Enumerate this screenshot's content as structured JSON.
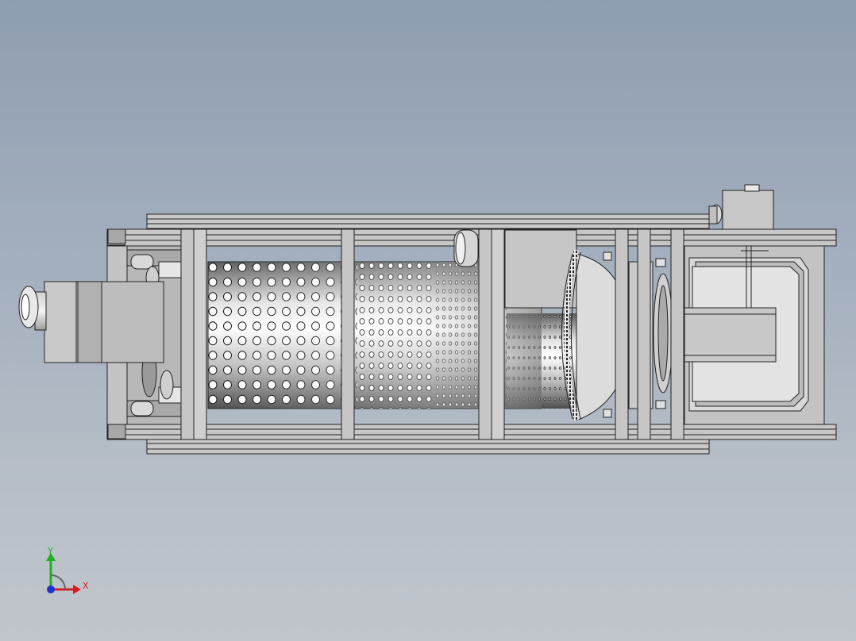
{
  "view": {
    "background_top": "#8f9db0",
    "background_bottom": "#c1c6cc"
  },
  "triad": {
    "x_label": "X",
    "y_label": "Y",
    "x_color": "#d42020",
    "y_color": "#20b020",
    "z_color": "#2030d0"
  }
}
